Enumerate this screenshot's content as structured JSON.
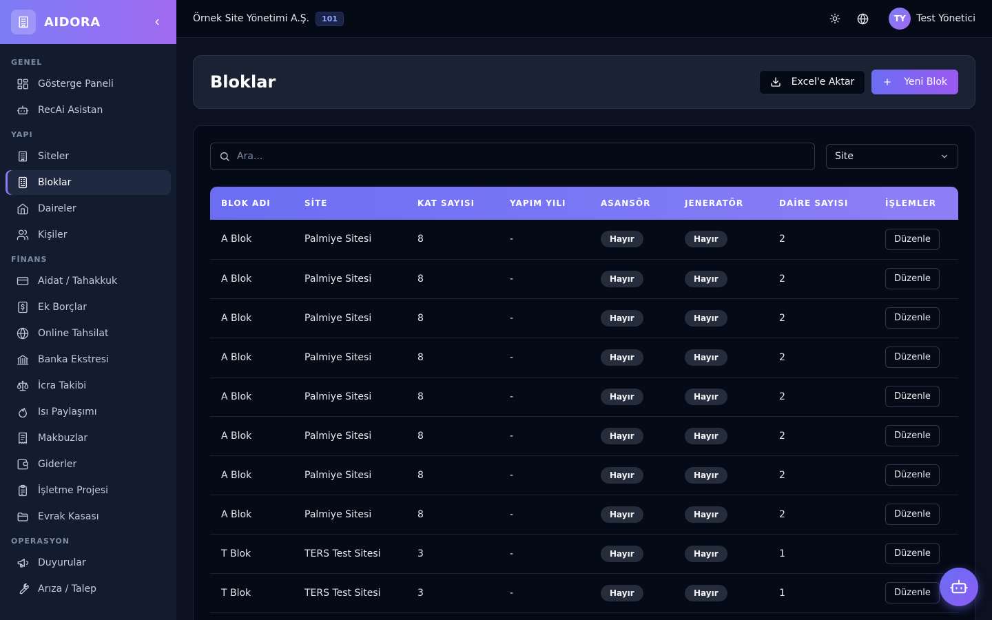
{
  "brand": {
    "name": "AIDORA",
    "logo_icon": "building-icon"
  },
  "sidebar": {
    "groups": [
      {
        "label": "GENEL",
        "items": [
          {
            "label": "Gösterge Paneli",
            "icon": "dashboard-icon"
          },
          {
            "label": "RecAi Asistan",
            "icon": "bot-icon"
          }
        ]
      },
      {
        "label": "YAPI",
        "items": [
          {
            "label": "Siteler",
            "icon": "building-icon"
          },
          {
            "label": "Bloklar",
            "icon": "block-icon",
            "active": true
          },
          {
            "label": "Daireler",
            "icon": "home-icon"
          },
          {
            "label": "Kişiler",
            "icon": "users-icon"
          }
        ]
      },
      {
        "label": "FİNANS",
        "items": [
          {
            "label": "Aidat / Tahakkuk",
            "icon": "credit-card-icon"
          },
          {
            "label": "Ek Borçlar",
            "icon": "dollar-receipt-icon"
          },
          {
            "label": "Online Tahsilat",
            "icon": "globe-icon"
          },
          {
            "label": "Banka Ekstresi",
            "icon": "bank-icon"
          },
          {
            "label": "İcra Takibi",
            "icon": "scale-icon"
          },
          {
            "label": "Isı Paylaşımı",
            "icon": "flame-icon"
          },
          {
            "label": "Makbuzlar",
            "icon": "receipt-icon"
          },
          {
            "label": "Giderler",
            "icon": "wallet-icon"
          },
          {
            "label": "İşletme Projesi",
            "icon": "clipboard-icon"
          },
          {
            "label": "Evrak Kasası",
            "icon": "folder-icon"
          }
        ]
      },
      {
        "label": "OPERASYON",
        "items": [
          {
            "label": "Duyurular",
            "icon": "megaphone-icon"
          },
          {
            "label": "Arıza / Talep",
            "icon": "wrench-icon"
          }
        ]
      }
    ]
  },
  "topbar": {
    "org_name": "Örnek Site Yönetimi A.Ş.",
    "org_badge": "101",
    "user_initials": "TY",
    "user_name": "Test Yönetici"
  },
  "page": {
    "title": "Bloklar",
    "export_label": "Excel'e Aktar",
    "new_label": "Yeni Blok"
  },
  "filters": {
    "search_placeholder": "Ara...",
    "site_select": "Site"
  },
  "table": {
    "columns": [
      "BLOK ADI",
      "SİTE",
      "KAT SAYISI",
      "YAPIM YILI",
      "ASANSÖR",
      "JENERATÖR",
      "DAİRE SAYISI",
      "İŞLEMLER"
    ],
    "rows": [
      {
        "name": "A Blok",
        "site": "Palmiye Sitesi",
        "floors": "8",
        "year": "-",
        "elevator": "Hayır",
        "generator": "Hayır",
        "units": "2",
        "action": "Düzenle"
      },
      {
        "name": "A Blok",
        "site": "Palmiye Sitesi",
        "floors": "8",
        "year": "-",
        "elevator": "Hayır",
        "generator": "Hayır",
        "units": "2",
        "action": "Düzenle"
      },
      {
        "name": "A Blok",
        "site": "Palmiye Sitesi",
        "floors": "8",
        "year": "-",
        "elevator": "Hayır",
        "generator": "Hayır",
        "units": "2",
        "action": "Düzenle"
      },
      {
        "name": "A Blok",
        "site": "Palmiye Sitesi",
        "floors": "8",
        "year": "-",
        "elevator": "Hayır",
        "generator": "Hayır",
        "units": "2",
        "action": "Düzenle"
      },
      {
        "name": "A Blok",
        "site": "Palmiye Sitesi",
        "floors": "8",
        "year": "-",
        "elevator": "Hayır",
        "generator": "Hayır",
        "units": "2",
        "action": "Düzenle"
      },
      {
        "name": "A Blok",
        "site": "Palmiye Sitesi",
        "floors": "8",
        "year": "-",
        "elevator": "Hayır",
        "generator": "Hayır",
        "units": "2",
        "action": "Düzenle"
      },
      {
        "name": "A Blok",
        "site": "Palmiye Sitesi",
        "floors": "8",
        "year": "-",
        "elevator": "Hayır",
        "generator": "Hayır",
        "units": "2",
        "action": "Düzenle"
      },
      {
        "name": "A Blok",
        "site": "Palmiye Sitesi",
        "floors": "8",
        "year": "-",
        "elevator": "Hayır",
        "generator": "Hayır",
        "units": "2",
        "action": "Düzenle"
      },
      {
        "name": "T Blok",
        "site": "TERS Test Sitesi",
        "floors": "3",
        "year": "-",
        "elevator": "Hayır",
        "generator": "Hayır",
        "units": "1",
        "action": "Düzenle"
      },
      {
        "name": "T Blok",
        "site": "TERS Test Sitesi",
        "floors": "3",
        "year": "-",
        "elevator": "Hayır",
        "generator": "Hayır",
        "units": "1",
        "action": "Düzenle"
      }
    ]
  },
  "colors": {
    "accent": "#6b6ef2",
    "accent2": "#9b59f0",
    "bg": "#0b1120",
    "sidebar": "#131b2e"
  }
}
